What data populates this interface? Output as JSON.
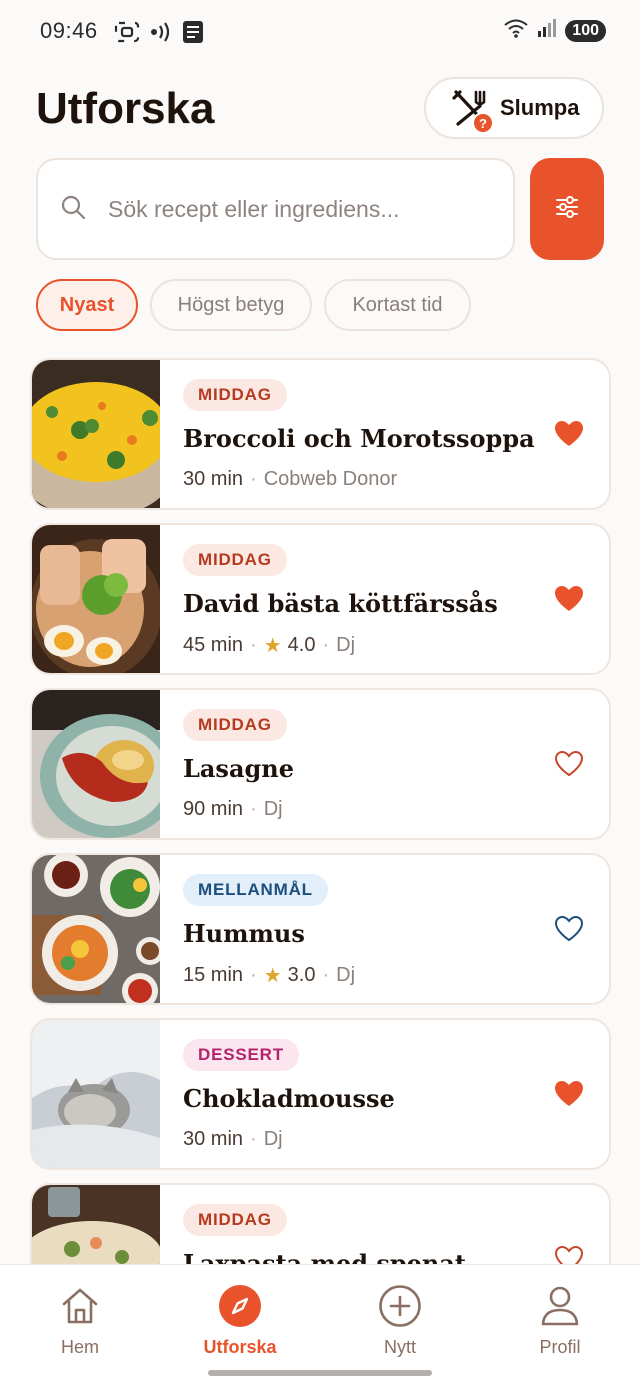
{
  "status": {
    "time": "09:46",
    "battery": "100"
  },
  "header": {
    "title": "Utforska",
    "random_label": "Slumpa",
    "random_badge": "?"
  },
  "search": {
    "placeholder": "Sök recept eller ingrediens..."
  },
  "sort_chips": [
    {
      "label": "Nyast",
      "active": true
    },
    {
      "label": "Högst betyg",
      "active": false
    },
    {
      "label": "Kortast tid",
      "active": false
    }
  ],
  "recipes": [
    {
      "category": "MIDDAG",
      "title": "Broccoli och Morotssoppa",
      "time": "30 min",
      "rating": null,
      "author": "Cobweb Donor",
      "favorite": true
    },
    {
      "category": "MIDDAG",
      "title": "David bästa köttfärssås",
      "time": "45 min",
      "rating": "4.0",
      "author": "Dj",
      "favorite": true
    },
    {
      "category": "MIDDAG",
      "title": "Lasagne",
      "time": "90 min",
      "rating": null,
      "author": "Dj",
      "favorite": false
    },
    {
      "category": "MELLANMÅL",
      "title": "Hummus",
      "time": "15 min",
      "rating": "3.0",
      "author": "Dj",
      "favorite": false
    },
    {
      "category": "DESSERT",
      "title": "Chokladmousse",
      "time": "30 min",
      "rating": null,
      "author": "Dj",
      "favorite": true
    },
    {
      "category": "MIDDAG",
      "title": "Laxpasta med spenat",
      "time": "",
      "rating": null,
      "author": "",
      "favorite": false
    }
  ],
  "meta_separator": "·",
  "star_glyph": "★",
  "nav": [
    {
      "label": "Hem",
      "icon": "home-icon",
      "active": false
    },
    {
      "label": "Utforska",
      "icon": "compass-icon",
      "active": true
    },
    {
      "label": "Nytt",
      "icon": "plus-circle-icon",
      "active": false
    },
    {
      "label": "Profil",
      "icon": "user-icon",
      "active": false
    }
  ],
  "colors": {
    "accent": "#e8532b",
    "background": "#fcfaf8",
    "heart_outline_blue": "#1c4f7e"
  }
}
